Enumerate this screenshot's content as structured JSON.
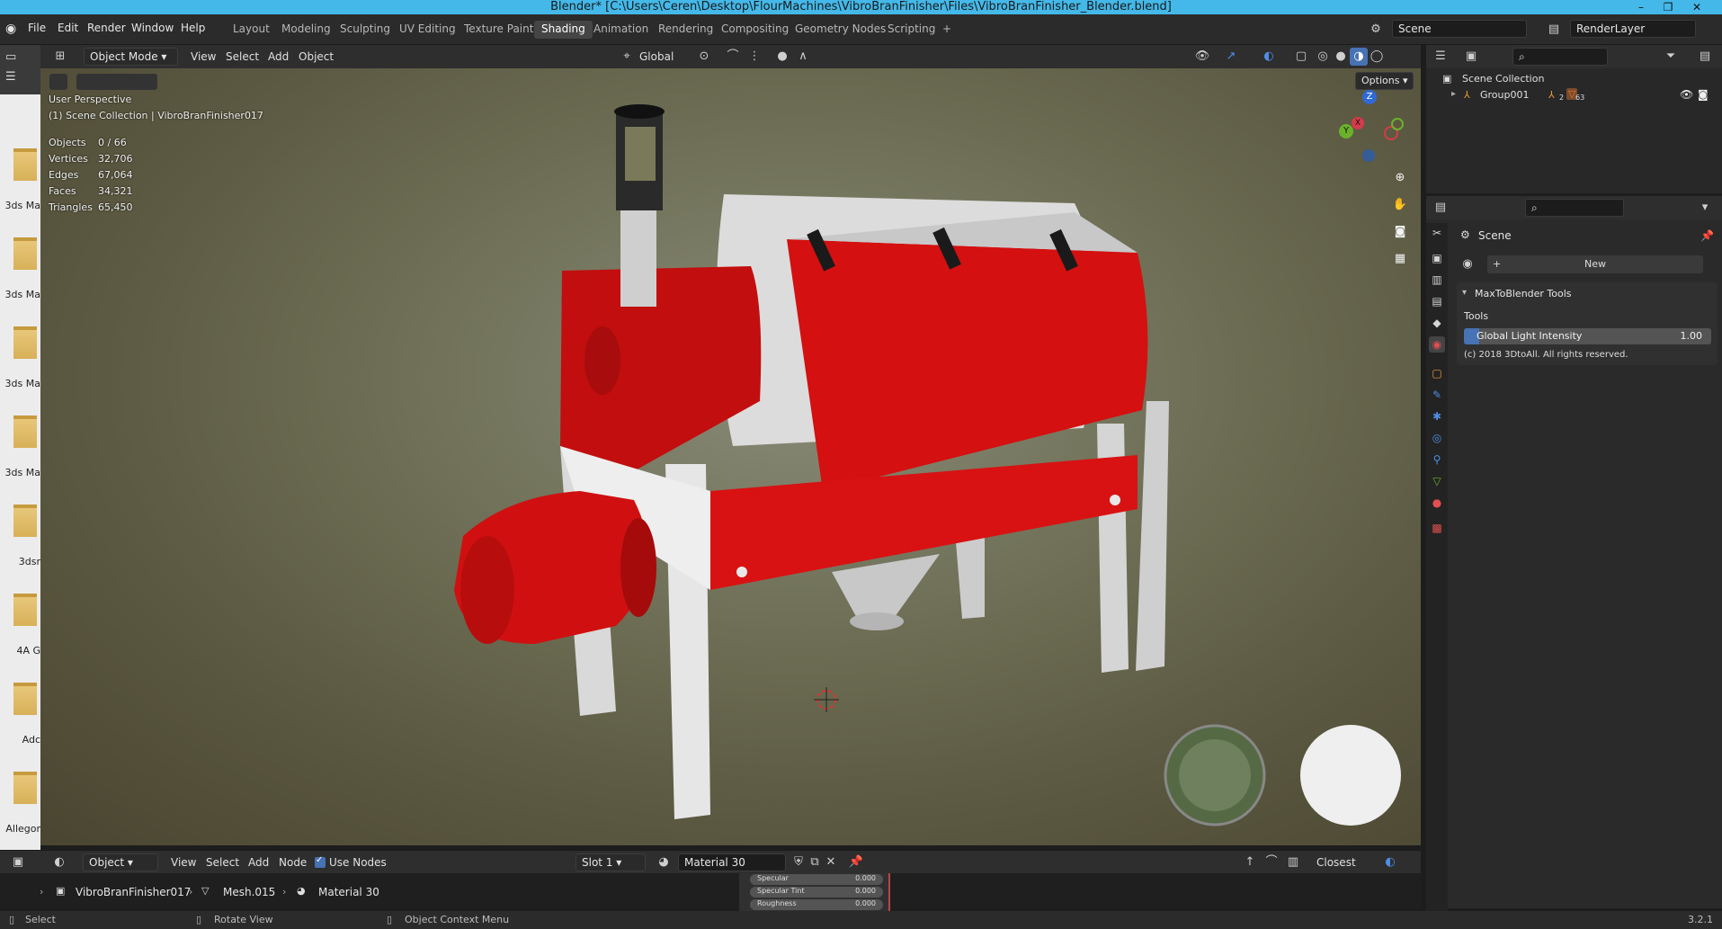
{
  "window": {
    "title": "Blender* [C:\\Users\\Ceren\\Desktop\\FlourMachines\\VibroBranFinisher\\Files\\VibroBranFinisher_Blender.blend]",
    "minimize": "–",
    "maximize": "❐",
    "close": "✕"
  },
  "menu": [
    "File",
    "Edit",
    "Render",
    "Window",
    "Help"
  ],
  "workspaces": [
    "Layout",
    "Modeling",
    "Sculpting",
    "UV Editing",
    "Texture Paint",
    "Shading",
    "Animation",
    "Rendering",
    "Compositing",
    "Geometry Nodes",
    "Scripting"
  ],
  "add_workspace": "+",
  "scene_field": "Scene",
  "view_layer_field": "RenderLayer",
  "left_strip": {
    "folders": [
      "3ds Ma",
      "3ds Ma",
      "3ds Ma",
      "3ds Ma",
      "3dsr",
      "4A G",
      "Adc",
      "Allegor"
    ]
  },
  "viewport_header": {
    "mode": "Object Mode",
    "menus": [
      "View",
      "Select",
      "Add",
      "Object"
    ],
    "orientation": "Global",
    "options": "Options"
  },
  "viewport": {
    "perspective": "User Perspective",
    "collection_path": "(1) Scene Collection | VibroBranFinisher017",
    "stats": [
      {
        "label": "Objects",
        "value": "0 / 66"
      },
      {
        "label": "Vertices",
        "value": "32,706"
      },
      {
        "label": "Edges",
        "value": "67,064"
      },
      {
        "label": "Faces",
        "value": "34,321"
      },
      {
        "label": "Triangles",
        "value": "65,450"
      }
    ],
    "gizmo_axes": [
      "Z",
      "Y",
      "X"
    ]
  },
  "outliner": {
    "root": "Scene Collection",
    "items": [
      {
        "name": "Group001",
        "badge1": "2",
        "badge2": "63"
      }
    ]
  },
  "properties": {
    "scene_label": "Scene",
    "new_button": "New",
    "panel_title": "MaxToBlender Tools",
    "tools_label": "Tools",
    "slider_label": "Global Light Intensity",
    "slider_value": "1.00",
    "slider_fraction": 0.06,
    "copyright": "(c) 2018 3DtoAll. All rights reserved."
  },
  "node_header": {
    "editor_type": "Object",
    "menus": [
      "View",
      "Select",
      "Add",
      "Node"
    ],
    "use_nodes": "Use Nodes",
    "slot": "Slot 1",
    "material": "Material 30",
    "interpolation": "Closest"
  },
  "breadcrumbs": [
    "VibroBranFinisher017",
    "Mesh.015",
    "Material 30"
  ],
  "node_sockets": [
    {
      "label": "Specular",
      "value": "0.000"
    },
    {
      "label": "Specular Tint",
      "value": "0.000"
    },
    {
      "label": "Roughness",
      "value": "0.000"
    }
  ],
  "statusbar": {
    "select": "Select",
    "rotate": "Rotate View",
    "context": "Object Context Menu",
    "version": "3.2.1"
  },
  "colors": {
    "accent_blue": "#4772b3",
    "title_bar": "#44b8e8",
    "machine_red": "#d41010"
  }
}
